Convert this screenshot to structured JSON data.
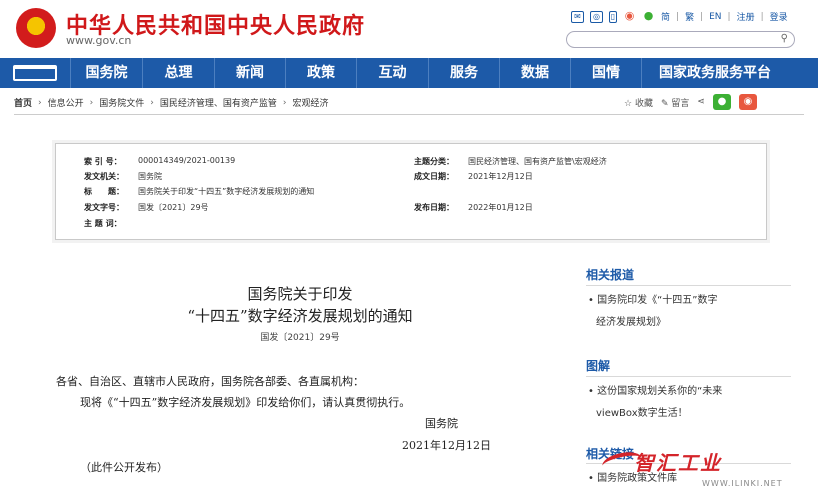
{
  "header": {
    "site_name": "中华人民共和国中央人民政府",
    "url": "www.gov.cn",
    "links": [
      "简",
      "繁",
      "EN",
      "注册",
      "登录"
    ]
  },
  "nav": {
    "items": [
      "国务院",
      "总理",
      "新闻",
      "政策",
      "互动",
      "服务",
      "数据",
      "国情",
      "国家政务服务平台"
    ]
  },
  "breadcrumb": [
    "首页",
    "信息公开",
    "国务院文件",
    "国民经济管理、国有资产监管",
    "宏观经济"
  ],
  "tools": {
    "favorite": "收藏",
    "message": "留言"
  },
  "meta": {
    "index_key": "索 引 号：",
    "index_val": "000014349/2021-00139",
    "topic_key": "主题分类：",
    "topic_val": "国民经济管理、国有资产监管\\宏观经济",
    "issuer_key": "发文机关：",
    "issuer_val": "国务院",
    "written_key": "成文日期：",
    "written_val": "2021年12月12日",
    "title_key": "标　　题：",
    "title_val": "国务院关于印发“十四五”数字经济发展规划的通知",
    "docno_key": "发文字号：",
    "docno_val": "国发〔2021〕29号",
    "pub_key": "发布日期：",
    "pub_val": "2022年01月12日",
    "keywords_key": "主 题 词："
  },
  "article": {
    "title_line1": "国务院关于印发",
    "title_line2": "“十四五”数字经济发展规划的通知",
    "doc_number": "国发〔2021〕29号",
    "recipients": "各省、自治区、直辖市人民政府，国务院各部委、各直属机构：",
    "body": "现将《“十四五”数字经济发展规划》印发给你们，请认真贯彻执行。",
    "signer": "国务院",
    "date": "2021年12月12日",
    "note": "（此件公开发布）"
  },
  "sidebar": {
    "related_title": "相关报道",
    "related_item_1": "国务院印发《“十四五”数字",
    "related_item_2": "经济发展规划》",
    "graphic_title": "图解",
    "graphic_item_1": "这份国家规划关系你的“未来",
    "graphic_item_2": "viewBox数字生活！",
    "links_title": "相关链接",
    "links_item_1": "国务院政策文件库"
  },
  "watermark": {
    "logo": "智汇工业",
    "url": "WWW.ILINKI.NET"
  },
  "colors": {
    "brand_red": "#d0181a",
    "nav_blue": "#1d5aa8"
  }
}
